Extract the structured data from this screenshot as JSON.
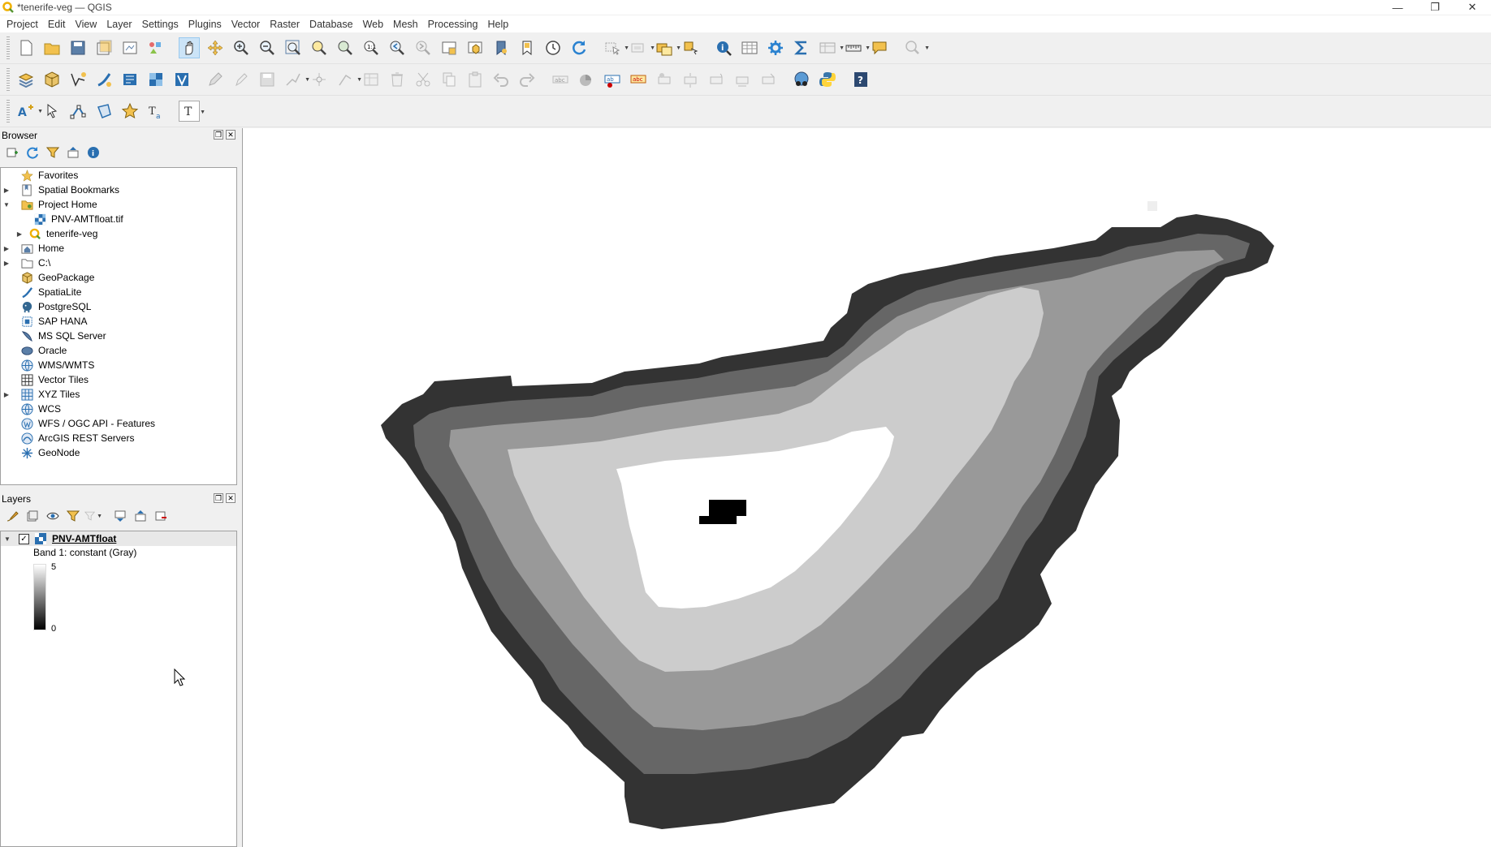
{
  "window": {
    "title": "*tenerife-veg — QGIS",
    "controls": {
      "minimize": "—",
      "restore": "❐",
      "close": "✕"
    }
  },
  "menu": [
    "Project",
    "Edit",
    "View",
    "Layer",
    "Settings",
    "Plugins",
    "Vector",
    "Raster",
    "Database",
    "Web",
    "Mesh",
    "Processing",
    "Help"
  ],
  "browser": {
    "title": "Browser",
    "items": [
      {
        "label": "Favorites",
        "icon": "star-icon",
        "expand": false,
        "level": 0
      },
      {
        "label": "Spatial Bookmarks",
        "icon": "bookmark-icon",
        "expand": "collapsed",
        "level": 0
      },
      {
        "label": "Project Home",
        "icon": "folder-icon",
        "expand": "expanded",
        "level": 0
      },
      {
        "label": "PNV-AMTfloat.tif",
        "icon": "raster-icon",
        "expand": false,
        "level": 1
      },
      {
        "label": "tenerife-veg",
        "icon": "qgis-project-icon",
        "expand": "collapsed",
        "level": 1
      },
      {
        "label": "Home",
        "icon": "home-folder-icon",
        "expand": "collapsed",
        "level": 0
      },
      {
        "label": "C:\\",
        "icon": "drive-folder-icon",
        "expand": "collapsed",
        "level": 0
      },
      {
        "label": "GeoPackage",
        "icon": "geopackage-icon",
        "expand": false,
        "level": 0
      },
      {
        "label": "SpatiaLite",
        "icon": "spatialite-icon",
        "expand": false,
        "level": 0
      },
      {
        "label": "PostgreSQL",
        "icon": "postgresql-icon",
        "expand": false,
        "level": 0
      },
      {
        "label": "SAP HANA",
        "icon": "saphana-icon",
        "expand": false,
        "level": 0
      },
      {
        "label": "MS SQL Server",
        "icon": "mssql-icon",
        "expand": false,
        "level": 0
      },
      {
        "label": "Oracle",
        "icon": "oracle-icon",
        "expand": false,
        "level": 0
      },
      {
        "label": "WMS/WMTS",
        "icon": "globe-icon",
        "expand": false,
        "level": 0
      },
      {
        "label": "Vector Tiles",
        "icon": "vector-tiles-icon",
        "expand": false,
        "level": 0
      },
      {
        "label": "XYZ Tiles",
        "icon": "xyz-tiles-icon",
        "expand": "collapsed",
        "level": 0
      },
      {
        "label": "WCS",
        "icon": "globe-icon",
        "expand": false,
        "level": 0
      },
      {
        "label": "WFS / OGC API - Features",
        "icon": "wfs-icon",
        "expand": false,
        "level": 0
      },
      {
        "label": "ArcGIS REST Servers",
        "icon": "arcgis-icon",
        "expand": false,
        "level": 0
      },
      {
        "label": "GeoNode",
        "icon": "geonode-icon",
        "expand": false,
        "level": 0
      }
    ]
  },
  "layers": {
    "title": "Layers",
    "layer": {
      "name": "PNV-AMTfloat",
      "checked": "✓",
      "band": "Band 1: constant (Gray)",
      "max": "5",
      "min": "0"
    }
  },
  "colors": {
    "class0": "#000000",
    "class1": "#333333",
    "class2": "#666666",
    "class3": "#999999",
    "class4": "#cccccc",
    "class5": "#ffffff"
  }
}
